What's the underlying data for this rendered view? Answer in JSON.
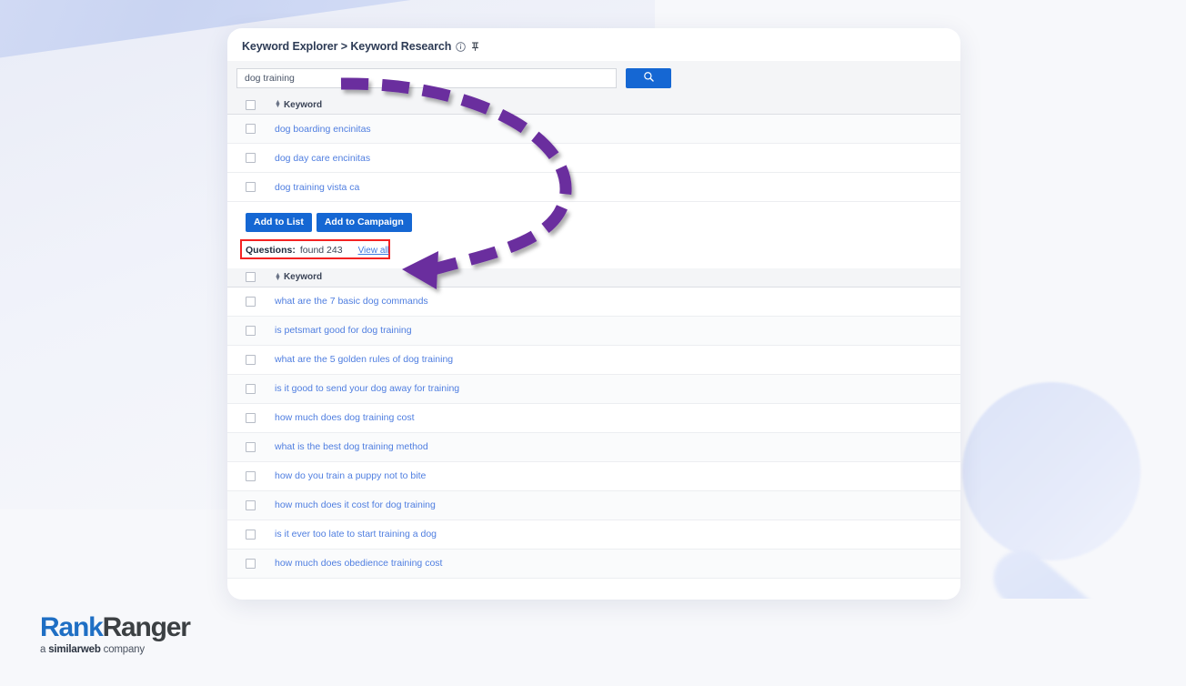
{
  "page": {
    "brand": {
      "name_part1": "Rank",
      "name_part2": "Ranger",
      "tagline_prefix": "a ",
      "tagline_bold": "similarweb",
      "tagline_suffix": " company"
    },
    "colors": {
      "primary_blue": "#1567d3",
      "link_blue": "#4f7ee0",
      "annotation_purple": "#6b2d9e",
      "highlight_red": "#f42222",
      "header_grey": "#f4f5f7"
    }
  },
  "card": {
    "breadcrumb": "Keyword Explorer > Keyword Research",
    "info_icon": "info-circle-icon",
    "pin_icon": "pin-icon"
  },
  "search": {
    "value": "dog training",
    "placeholder": "Enter keyword",
    "button_icon": "search-icon"
  },
  "keyword_table": {
    "columns": [
      "Keyword"
    ],
    "sort_icon": "sort-updown-icon",
    "rows": [
      {
        "keyword": "dog boarding encinitas"
      },
      {
        "keyword": "dog day care encinitas"
      },
      {
        "keyword": "dog training vista ca"
      }
    ]
  },
  "actions": {
    "add_to_list": "Add to List",
    "add_to_campaign": "Add to Campaign"
  },
  "questions": {
    "label": "Questions:",
    "found_text": "found 243",
    "count": 243,
    "view_all": "View all"
  },
  "questions_table": {
    "columns": [
      "Keyword"
    ],
    "sort_icon": "sort-updown-icon",
    "rows": [
      {
        "keyword": "what are the 7 basic dog commands"
      },
      {
        "keyword": "is petsmart good for dog training"
      },
      {
        "keyword": "what are the 5 golden rules of dog training"
      },
      {
        "keyword": "is it good to send your dog away for training"
      },
      {
        "keyword": "how much does dog training cost"
      },
      {
        "keyword": "what is the best dog training method"
      },
      {
        "keyword": "how do you train a puppy not to bite"
      },
      {
        "keyword": "how much does it cost for dog training"
      },
      {
        "keyword": "is it ever too late to start training a dog"
      },
      {
        "keyword": "how much does obedience training cost"
      }
    ]
  }
}
